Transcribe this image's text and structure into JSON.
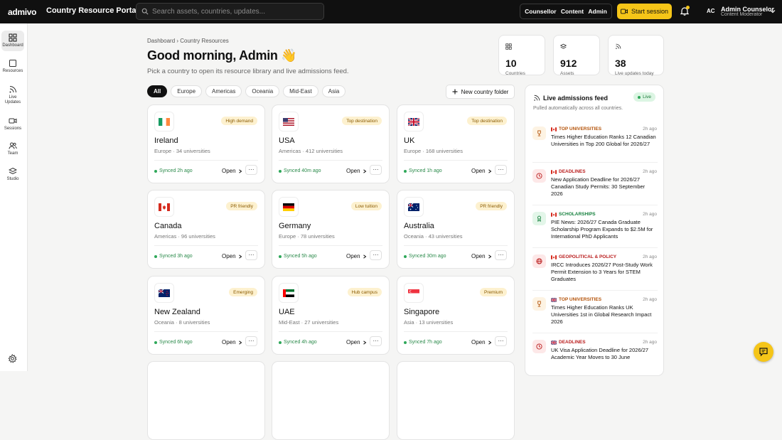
{
  "topbar": {
    "logo": "admivo",
    "portal_title": "Country Resource Portal",
    "search_placeholder": "Search assets, countries, updates...",
    "segments": [
      "Counsellor",
      "Content",
      "Admin"
    ],
    "start_session": "Start session",
    "user_initials": "AC",
    "user_name": "Admin Counselor",
    "user_role": "Content Moderator"
  },
  "sidebar": {
    "items": [
      {
        "label": "Dashboard",
        "icon": "grid-icon",
        "active": true
      },
      {
        "label": "Resources",
        "icon": "square-icon"
      },
      {
        "label": "Live Updates",
        "icon": "rss-icon"
      },
      {
        "label": "Sessions",
        "icon": "video-icon"
      },
      {
        "label": "Team",
        "icon": "users-icon"
      },
      {
        "label": "Studio",
        "icon": "layers-icon"
      }
    ]
  },
  "header": {
    "breadcrumb": "Dashboard › Country Resources",
    "greeting": "Good morning, Admin 👋",
    "subtitle": "Pick a country to open its resource library and live admissions feed."
  },
  "stats": [
    {
      "value": "10",
      "label": "Countries",
      "icon": "grid-icon"
    },
    {
      "value": "912",
      "label": "Assets",
      "icon": "layers-icon"
    },
    {
      "value": "38",
      "label": "Live updates today",
      "icon": "rss-icon"
    }
  ],
  "filters": [
    "All",
    "Europe",
    "Americas",
    "Oceania",
    "Mid-East",
    "Asia"
  ],
  "new_folder": "New country folder",
  "open_label": "Open",
  "more_label": "···",
  "countries": [
    {
      "name": "Ireland",
      "meta": "Europe · 34 universities",
      "badge": "High demand",
      "synced": "Synced 2h ago",
      "flag": "ie"
    },
    {
      "name": "USA",
      "meta": "Americas · 412 universities",
      "badge": "Top destination",
      "synced": "Synced 40m ago",
      "flag": "us"
    },
    {
      "name": "UK",
      "meta": "Europe · 168 universities",
      "badge": "Top destination",
      "synced": "Synced 1h ago",
      "flag": "uk"
    },
    {
      "name": "Canada",
      "meta": "Americas · 96 universities",
      "badge": "PR friendly",
      "synced": "Synced 3h ago",
      "flag": "ca"
    },
    {
      "name": "Germany",
      "meta": "Europe · 78 universities",
      "badge": "Low tuition",
      "synced": "Synced 5h ago",
      "flag": "de"
    },
    {
      "name": "Australia",
      "meta": "Oceania · 43 universities",
      "badge": "PR friendly",
      "synced": "Synced 30m ago",
      "flag": "au"
    },
    {
      "name": "New Zealand",
      "meta": "Oceania · 8 universities",
      "badge": "Emerging",
      "synced": "Synced 6h ago",
      "flag": "nz"
    },
    {
      "name": "UAE",
      "meta": "Mid-East · 27 universities",
      "badge": "Hub campus",
      "synced": "Synced 4h ago",
      "flag": "ae"
    },
    {
      "name": "Singapore",
      "meta": "Asia · 13 universities",
      "badge": "Premium",
      "synced": "Synced 7h ago",
      "flag": "sg"
    }
  ],
  "feed": {
    "title": "Live admissions feed",
    "live": "Live",
    "subtitle": "Pulled automatically across all countries.",
    "items": [
      {
        "category": "TOP UNIVERSITIES",
        "time": "2h ago",
        "headline": "Times Higher Education Ranks 12 Canadian Universities in Top 200 Global for 2026/27",
        "flag": "ca",
        "kind": "trophy",
        "color": "#b45309",
        "bg": "#fdf3e3"
      },
      {
        "category": "DEADLINES",
        "time": "2h ago",
        "headline": "New Application Deadline for 2026/27 Canadian Study Permits: 30 September 2026",
        "flag": "ca",
        "kind": "clock",
        "color": "#b91c1c",
        "bg": "#fde8e8"
      },
      {
        "category": "SCHOLARSHIPS",
        "time": "2h ago",
        "headline": "PIE News: 2026/27 Canada Graduate Scholarship Program Expands to $2.5M for International PhD Applicants",
        "flag": "ca",
        "kind": "award",
        "color": "#15803d",
        "bg": "#e3f6e9"
      },
      {
        "category": "GEOPOLITICAL & POLICY",
        "time": "2h ago",
        "headline": "IRCC Introduces 2026/27 Post-Study Work Permit Extension to 3 Years for STEM Graduates",
        "flag": "ca",
        "kind": "globe",
        "color": "#b91c1c",
        "bg": "#fde8e8"
      },
      {
        "category": "TOP UNIVERSITIES",
        "time": "2h ago",
        "headline": "Times Higher Education Ranks UK Universities 1st in Global Research Impact 2026",
        "flag": "uk",
        "kind": "trophy",
        "color": "#b45309",
        "bg": "#fdf3e3"
      },
      {
        "category": "DEADLINES",
        "time": "2h ago",
        "headline": "UK Visa Application Deadline for 2026/27 Academic Year Moves to 30 June",
        "flag": "uk",
        "kind": "clock",
        "color": "#b91c1c",
        "bg": "#fde8e8"
      }
    ]
  },
  "colors": {
    "accent": "#f5c518",
    "topbar": "#101010",
    "success": "#2fa85a"
  }
}
